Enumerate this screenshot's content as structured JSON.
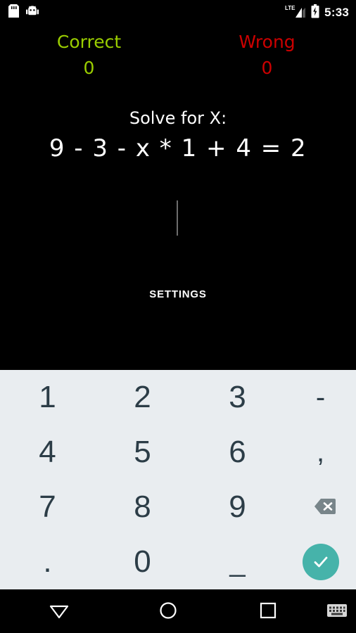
{
  "status_bar": {
    "icons_left": [
      "sd-card-icon",
      "android-icon"
    ],
    "network_label": "LTE",
    "icons_right": [
      "signal-icon",
      "battery-charging-icon"
    ],
    "time": "5:33"
  },
  "app": {
    "score": {
      "correct_label": "Correct",
      "correct_value": "0",
      "correct_color": "#9ACD00",
      "wrong_label": "Wrong",
      "wrong_value": "0",
      "wrong_color": "#CC0000"
    },
    "prompt": "Solve for X:",
    "equation": "9 - 3 - x * 1 + 4 = 2",
    "answer": {
      "value": "",
      "placeholder": ""
    },
    "settings_label": "SETTINGS"
  },
  "keyboard": {
    "background": "#E9EDF0",
    "key_color": "#2C3D47",
    "enter_color": "#46B3AA",
    "backspace_color": "#78858A",
    "rows": [
      [
        {
          "name": "key-1",
          "label": "1"
        },
        {
          "name": "key-2",
          "label": "2"
        },
        {
          "name": "key-3",
          "label": "3"
        },
        {
          "name": "key-minus",
          "label": "-"
        }
      ],
      [
        {
          "name": "key-4",
          "label": "4"
        },
        {
          "name": "key-5",
          "label": "5"
        },
        {
          "name": "key-6",
          "label": "6"
        },
        {
          "name": "key-comma",
          "label": ","
        }
      ],
      [
        {
          "name": "key-7",
          "label": "7"
        },
        {
          "name": "key-8",
          "label": "8"
        },
        {
          "name": "key-9",
          "label": "9"
        },
        {
          "name": "key-backspace",
          "label": "backspace-icon"
        }
      ],
      [
        {
          "name": "key-period",
          "label": "."
        },
        {
          "name": "key-0",
          "label": "0"
        },
        {
          "name": "key-underscore",
          "label": "_"
        },
        {
          "name": "key-enter",
          "label": "check-icon"
        }
      ]
    ]
  },
  "nav_bar": {
    "back_icon": "triangle-down-icon",
    "home_icon": "circle-icon",
    "recents_icon": "square-icon",
    "keyboard_icon": "keyboard-icon"
  }
}
